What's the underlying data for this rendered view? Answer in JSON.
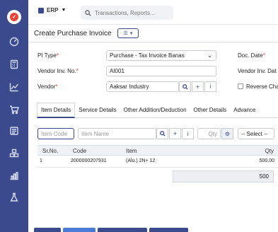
{
  "topbar": {
    "module_label": "ERP",
    "search_placeholder": "Transactions, Reports..."
  },
  "header": {
    "title": "Create Purchase Invoice"
  },
  "form": {
    "pi_type_label": "PI Type",
    "pi_type_value": "Purchase - Tax Invoice Banas",
    "vendor_inv_no_label": "Vendor Inv. No.",
    "vendor_inv_no_value": "AI001",
    "vendor_label": "Vendor",
    "vendor_value": "Aaksar Industry",
    "doc_date_label": "Doc. Date",
    "vendor_inv_date_label": "Vendor Inv. Dat",
    "reverse_charge_label": "Reverse Cha"
  },
  "tabs": [
    {
      "label": "Item Details"
    },
    {
      "label": "Service Details"
    },
    {
      "label": "Other Addition/Deduction"
    },
    {
      "label": "Other Details"
    },
    {
      "label": "Advance"
    }
  ],
  "entry": {
    "item_code_placeholder": "Item Code",
    "item_name_placeholder": "Item Name",
    "qty_placeholder": "Qty",
    "select_placeholder": "-- Select --"
  },
  "table": {
    "columns": [
      "Sr.No.",
      "Code",
      "Item",
      "Qty"
    ],
    "rows": [
      {
        "sr": "1",
        "code": "2000000207931",
        "item": "(Alu.) 2N+ 12",
        "qty": "500.00"
      }
    ],
    "total_qty": "500"
  },
  "colors": {
    "sidebar": "#3a4a8c",
    "accent": "#3a4a8c",
    "required": "#e0352a"
  }
}
